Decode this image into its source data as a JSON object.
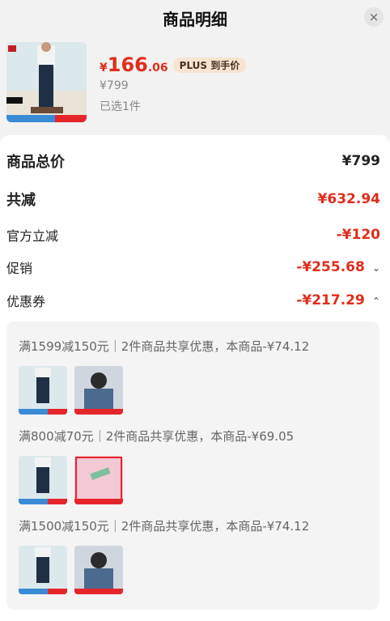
{
  "header": {
    "title": "商品明细",
    "close_icon": "×"
  },
  "product": {
    "currency_symbol": "¥",
    "price_integer": "166",
    "price_decimal": ".06",
    "plus_badge_brand": "PLUS",
    "plus_badge_text": "到手价",
    "original_price": "¥799",
    "selected_text": "已选1件"
  },
  "summary": {
    "total_label": "商品总价",
    "total_value": "¥799",
    "reduce_label": "共减",
    "reduce_value": "¥632.94",
    "official_label": "官方立减",
    "official_value": "-¥120",
    "promo_label": "促销",
    "promo_value": "-¥255.68",
    "coupon_label": "优惠券",
    "coupon_value": "-¥217.29"
  },
  "coupons": [
    {
      "text": "满1599减150元｜2件商品共享优惠，本商品-¥74.12"
    },
    {
      "text": "满800减70元｜2件商品共享优惠，本商品-¥69.05"
    },
    {
      "text": "满1500减150元｜2件商品共享优惠，本商品-¥74.12"
    }
  ],
  "colors": {
    "accent_red": "#e02d1c",
    "plus_badge_bg": "#f7e3d0"
  }
}
